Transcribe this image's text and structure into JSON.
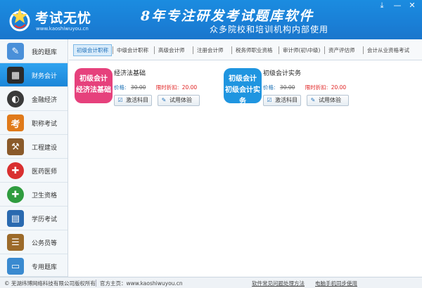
{
  "header": {
    "logo_title": "考试无忧",
    "logo_url": "www.kaoshiwuyou.cn",
    "slogan": "8年专注研发考试题库软件",
    "subslogan": "众多院校和培训机构内部使用",
    "controls": [
      "download-icon",
      "minimize-icon",
      "close-icon"
    ]
  },
  "sidebar": {
    "items": [
      {
        "label": "我的题库",
        "icon": "pencil-ruler-icon",
        "icon_color": "#4a90d9"
      },
      {
        "label": "财务会计",
        "icon": "calculator-icon",
        "icon_color": "#2b2b2b",
        "active": true
      },
      {
        "label": "金融经济",
        "icon": "globe-icon",
        "icon_color": "#3a3a3a"
      },
      {
        "label": "职称考试",
        "icon": "exam-seal-icon",
        "icon_color": "#e07a1a"
      },
      {
        "label": "工程建设",
        "icon": "engineering-icon",
        "icon_color": "#8a5a2a"
      },
      {
        "label": "医药医师",
        "icon": "medical-cross-icon",
        "icon_color": "#d93030"
      },
      {
        "label": "卫生资格",
        "icon": "health-cross-icon",
        "icon_color": "#2f9c3f"
      },
      {
        "label": "学历考试",
        "icon": "book-icon",
        "icon_color": "#2a6ab0"
      },
      {
        "label": "公务员等",
        "icon": "books-stack-icon",
        "icon_color": "#9c6a2a"
      },
      {
        "label": "专用题库",
        "icon": "folder-icon",
        "icon_color": "#3a8ad0"
      }
    ]
  },
  "tabs": [
    {
      "label": "初级会计职称",
      "active": true
    },
    {
      "label": "中级会计职称"
    },
    {
      "label": "高级会计师"
    },
    {
      "label": "注册会计师"
    },
    {
      "label": "税务师职业资格"
    },
    {
      "label": "审计师(初\\中级)"
    },
    {
      "label": "资产评估师"
    },
    {
      "label": "会计从业资格考试"
    }
  ],
  "cards": [
    {
      "badge": "初级会计经济法基础",
      "badge_line1": "初级会计",
      "badge_line2": "经济法基础",
      "badge_color": "#e6417c",
      "title": "经济法基础",
      "price_label": "价格:",
      "price_old": "30.00",
      "discount_label": "限时折扣:",
      "discount_price": "20.00",
      "activate_label": "激活科目",
      "trial_label": "试用体验"
    },
    {
      "badge": "初级会计初级会计实务",
      "badge_line1": "初级会计",
      "badge_line2": "初级会计实务",
      "badge_color": "#1f95e0",
      "title": "初级会计实务",
      "price_label": "价格:",
      "price_old": "30.00",
      "discount_label": "限时折扣:",
      "discount_price": "20.00",
      "activate_label": "激活科目",
      "trial_label": "试用体验"
    }
  ],
  "footer": {
    "copyright": "© 芜湖纬博网络科技有限公司版权所有",
    "homepage": "官方主页：www.kaoshiwuyou.cn",
    "faq_link": "软件常见问题处理方法",
    "phone_link": "电脑手机同步使用"
  },
  "colors": {
    "header_blue": "#1b8ce0",
    "active_blue": "#1b86d8",
    "discount_red": "#e02020"
  }
}
